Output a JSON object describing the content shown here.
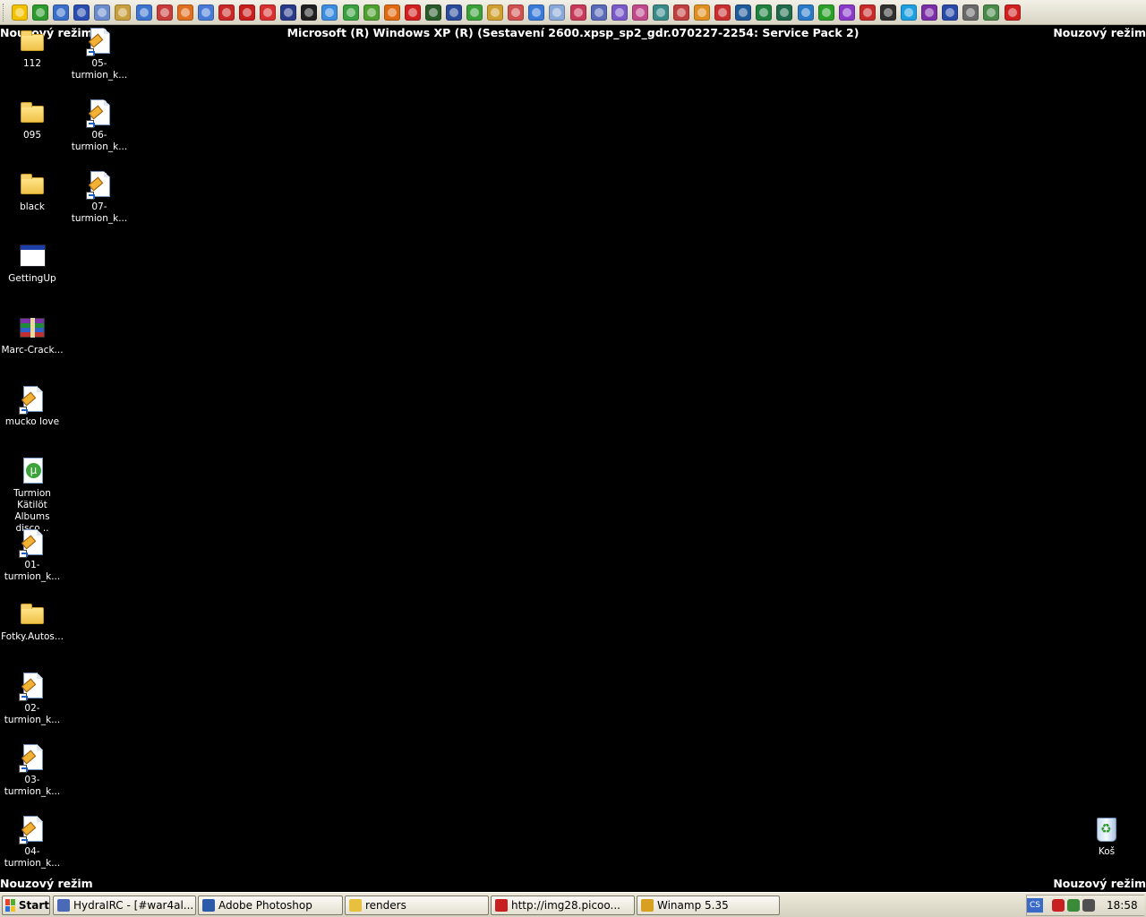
{
  "quick_launch": {
    "icons": [
      {
        "name": "winamp-icon",
        "color": "#f2c200"
      },
      {
        "name": "clover-icon",
        "color": "#2d9a2d"
      },
      {
        "name": "globe-icon",
        "color": "#3a6ec8"
      },
      {
        "name": "floppy-icon",
        "color": "#2b4db0"
      },
      {
        "name": "usb-icon",
        "color": "#6a8ccc"
      },
      {
        "name": "printer-icon",
        "color": "#c8a040"
      },
      {
        "name": "phone-icon",
        "color": "#3c74d0"
      },
      {
        "name": "tools-icon",
        "color": "#c83c3c"
      },
      {
        "name": "flame-icon",
        "color": "#e07020"
      },
      {
        "name": "pen-icon",
        "color": "#4a7ad8"
      },
      {
        "name": "tool-red-icon",
        "color": "#c82828"
      },
      {
        "name": "pdf-icon",
        "color": "#c81e1e"
      },
      {
        "name": "acrobat-icon",
        "color": "#d83030"
      },
      {
        "name": "media-icon",
        "color": "#2a3a8a"
      },
      {
        "name": "console-icon",
        "color": "#202020"
      },
      {
        "name": "messenger-icon",
        "color": "#3c8ce0"
      },
      {
        "name": "icq-icon",
        "color": "#3aa040"
      },
      {
        "name": "leaf-icon",
        "color": "#50a030"
      },
      {
        "name": "firefox-icon",
        "color": "#e06a10"
      },
      {
        "name": "opera-icon",
        "color": "#d02020"
      },
      {
        "name": "utorrent-icon",
        "color": "#2a5a2a"
      },
      {
        "name": "shield-icon",
        "color": "#2a4a9a"
      },
      {
        "name": "utorrent-green-icon",
        "color": "#3aa03a"
      },
      {
        "name": "ticket-icon",
        "color": "#d0a030"
      },
      {
        "name": "gear-icon",
        "color": "#d05050"
      },
      {
        "name": "ie-icon",
        "color": "#3a7ad8"
      },
      {
        "name": "snow-icon",
        "color": "#8aa8d8"
      },
      {
        "name": "music-icon",
        "color": "#c83a5a"
      },
      {
        "name": "photo-icon",
        "color": "#5a6ab8"
      },
      {
        "name": "frame-icon",
        "color": "#7a5ac8"
      },
      {
        "name": "wand-icon",
        "color": "#c04a8a"
      },
      {
        "name": "chart-icon",
        "color": "#3a8a8a"
      },
      {
        "name": "paint-icon",
        "color": "#c04040"
      },
      {
        "name": "clock-icon",
        "color": "#e09020"
      },
      {
        "name": "mp3-icon",
        "color": "#c83030"
      },
      {
        "name": "up-icon",
        "color": "#1f5a9a"
      },
      {
        "name": "ball-icon",
        "color": "#208040"
      },
      {
        "name": "clover-dark-icon",
        "color": "#1f6a4a"
      },
      {
        "name": "earth-icon",
        "color": "#2a7ac8"
      },
      {
        "name": "diamond-green-icon",
        "color": "#2aa02a"
      },
      {
        "name": "diamond-purple-icon",
        "color": "#8a3ac8"
      },
      {
        "name": "ball-red-icon",
        "color": "#c82a2a"
      },
      {
        "name": "football-icon",
        "color": "#303030"
      },
      {
        "name": "skype-icon",
        "color": "#1ea0e0"
      },
      {
        "name": "winrar-icon",
        "color": "#7a2fa8"
      },
      {
        "name": "word-icon",
        "color": "#2a4aa8"
      },
      {
        "name": "eye-icon",
        "color": "#6a6a6a"
      },
      {
        "name": "network-icon",
        "color": "#4a8a4a"
      },
      {
        "name": "opera-red-icon",
        "color": "#d02020"
      }
    ]
  },
  "safe_mode": {
    "label": "Nouzový režim",
    "os_version": "Microsoft (R) Windows XP (R) (Sestavení 2600.xpsp_sp2_gdr.070227-2254: Service Pack 2)"
  },
  "desktop": {
    "icons": [
      {
        "label": "112",
        "type": "folder"
      },
      {
        "label": "05-turmion_k...",
        "type": "shortcut"
      },
      {
        "label": "095",
        "type": "folder"
      },
      {
        "label": "06-turmion_k...",
        "type": "shortcut"
      },
      {
        "label": "black",
        "type": "folder"
      },
      {
        "label": "07-turmion_k...",
        "type": "shortcut"
      },
      {
        "label": "GettingUp",
        "type": "window"
      },
      {
        "label": "Marc-Crack...",
        "type": "rar"
      },
      {
        "label": "mucko love",
        "type": "shortcut"
      },
      {
        "label": "Turmion Kätilöt\nAlbums disco...",
        "type": "torrent"
      },
      {
        "label": "01-turmion_k...",
        "type": "shortcut"
      },
      {
        "label": "Fotky.Autos...",
        "type": "folder"
      },
      {
        "label": "02-turmion_k...",
        "type": "shortcut"
      },
      {
        "label": "03-turmion_k...",
        "type": "shortcut"
      },
      {
        "label": "04-turmion_k...",
        "type": "shortcut"
      },
      {
        "label": "Koš",
        "type": "recycle-bin"
      }
    ]
  },
  "taskbar": {
    "start_label": "Start",
    "buttons": [
      {
        "label": "HydraIRC - [#war4al...",
        "icon": "#4a6ab8"
      },
      {
        "label": "Adobe Photoshop",
        "icon": "#2a5aa8"
      },
      {
        "label": "renders",
        "icon": "#e8c040"
      },
      {
        "label": "http://img28.picoo...",
        "icon": "#c82020"
      },
      {
        "label": "Winamp 5.35",
        "icon": "#d8a020"
      }
    ],
    "tray": {
      "language": "CS",
      "icons": [
        {
          "name": "opera-tray-icon",
          "color": "#c82020"
        },
        {
          "name": "network-tray-icon",
          "color": "#3a8a3a"
        },
        {
          "name": "arrow-tray-icon",
          "color": "#505050"
        }
      ],
      "clock": "18:58"
    }
  }
}
